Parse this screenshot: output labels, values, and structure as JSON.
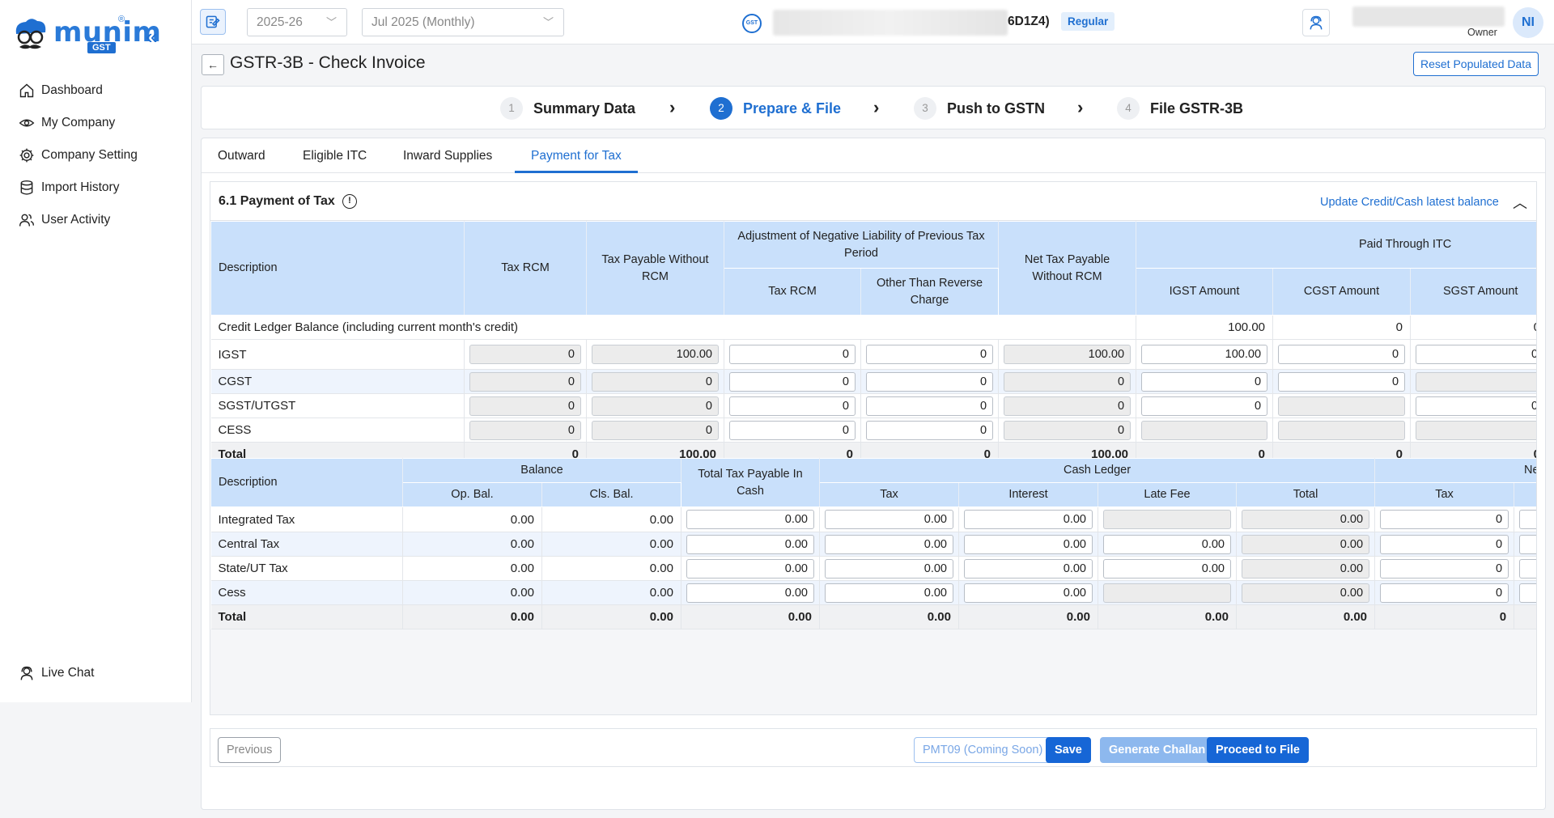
{
  "brand": {
    "name": "munim",
    "sub": "GST",
    "reg": "®"
  },
  "sidebar": {
    "items": [
      {
        "label": "Dashboard"
      },
      {
        "label": "My Company"
      },
      {
        "label": "Company Setting"
      },
      {
        "label": "Import History"
      },
      {
        "label": "User Activity"
      }
    ],
    "live_chat": "Live Chat"
  },
  "topbar": {
    "year": "2025-26",
    "period": "Jul 2025 (Monthly)",
    "gstin_tail": "6D1Z4)",
    "taxpayer_type": "Regular",
    "user_role": "Owner",
    "avatar_initials": "NI"
  },
  "page": {
    "title": "GSTR-3B - Check Invoice",
    "reset_label": "Reset Populated Data"
  },
  "steps": [
    {
      "num": "1",
      "label": "Summary Data"
    },
    {
      "num": "2",
      "label": "Prepare & File"
    },
    {
      "num": "3",
      "label": "Push to GSTN"
    },
    {
      "num": "4",
      "label": "File GSTR-3B"
    }
  ],
  "tabs": [
    "Outward",
    "Eligible ITC",
    "Inward Supplies",
    "Payment for Tax"
  ],
  "section": {
    "title": "6.1 Payment of Tax",
    "update_link": "Update Credit/Cash latest balance"
  },
  "table1": {
    "headers": {
      "description": "Description",
      "tax_rcm": "Tax RCM",
      "tax_payable": "Tax Payable Without RCM",
      "adjustment": "Adjustment of Negative Liability of Previous Tax Period",
      "adj_tax_rcm": "Tax RCM",
      "adj_other": "Other Than Reverse Charge",
      "net_tax": "Net Tax Payable Without RCM",
      "paid_itc": "Paid Through ITC",
      "igst": "IGST Amount",
      "cgst": "CGST Amount",
      "sgst": "SGST Amount"
    },
    "credit_ledger": {
      "label": "Credit Ledger Balance (including current month's credit)",
      "igst": "100.00",
      "cgst": "0",
      "sgst": "0"
    },
    "rows": [
      {
        "label": "IGST",
        "tax_rcm": "0",
        "tax_payable": "100.00",
        "adj_rcm": "0",
        "adj_other": "0",
        "net": "100.00",
        "igst": "100.00",
        "cgst": "0",
        "sgst": "0"
      },
      {
        "label": "CGST",
        "tax_rcm": "0",
        "tax_payable": "0",
        "adj_rcm": "0",
        "adj_other": "0",
        "net": "0",
        "igst": "0",
        "cgst": "0",
        "sgst": ""
      },
      {
        "label": "SGST/UTGST",
        "tax_rcm": "0",
        "tax_payable": "0",
        "adj_rcm": "0",
        "adj_other": "0",
        "net": "0",
        "igst": "0",
        "cgst": "",
        "sgst": "0"
      },
      {
        "label": "CESS",
        "tax_rcm": "0",
        "tax_payable": "0",
        "adj_rcm": "0",
        "adj_other": "0",
        "net": "0",
        "igst": "",
        "cgst": "",
        "sgst": ""
      }
    ],
    "total": {
      "label": "Total",
      "tax_rcm": "0",
      "tax_payable": "100.00",
      "adj_rcm": "0",
      "adj_other": "0",
      "net": "100.00",
      "igst": "0",
      "cgst": "0",
      "sgst": "0"
    }
  },
  "table2": {
    "headers": {
      "description": "Description",
      "balance": "Balance",
      "op_bal": "Op. Bal.",
      "cls_bal": "Cls. Bal.",
      "total_cash": "Total Tax Payable In Cash",
      "cash_ledger": "Cash Ledger",
      "tax": "Tax",
      "interest": "Interest",
      "late_fee": "Late Fee",
      "total": "Total",
      "ne": "Ne",
      "ne_tax": "Tax"
    },
    "rows": [
      {
        "label": "Integrated Tax",
        "op": "0.00",
        "cls": "0.00",
        "cash": "0.00",
        "tax": "0.00",
        "interest": "0.00",
        "late": "",
        "total": "0.00",
        "ne_tax": "0"
      },
      {
        "label": "Central Tax",
        "op": "0.00",
        "cls": "0.00",
        "cash": "0.00",
        "tax": "0.00",
        "interest": "0.00",
        "late": "0.00",
        "total": "0.00",
        "ne_tax": "0"
      },
      {
        "label": "State/UT Tax",
        "op": "0.00",
        "cls": "0.00",
        "cash": "0.00",
        "tax": "0.00",
        "interest": "0.00",
        "late": "0.00",
        "total": "0.00",
        "ne_tax": "0"
      },
      {
        "label": "Cess",
        "op": "0.00",
        "cls": "0.00",
        "cash": "0.00",
        "tax": "0.00",
        "interest": "0.00",
        "late": "",
        "total": "0.00",
        "ne_tax": "0"
      }
    ],
    "total": {
      "label": "Total",
      "op": "0.00",
      "cls": "0.00",
      "cash": "0.00",
      "tax": "0.00",
      "interest": "0.00",
      "late": "0.00",
      "total": "0.00",
      "ne_tax": "0"
    }
  },
  "buttons": {
    "previous": "Previous",
    "pmt09": "PMT09 (Coming Soon)",
    "save": "Save",
    "challan": "Generate Challan",
    "proceed": "Proceed to File"
  },
  "colors": {
    "primary": "#1f6fd1",
    "header_bg": "#c9e0fb",
    "row_alt": "#eef4fd"
  }
}
